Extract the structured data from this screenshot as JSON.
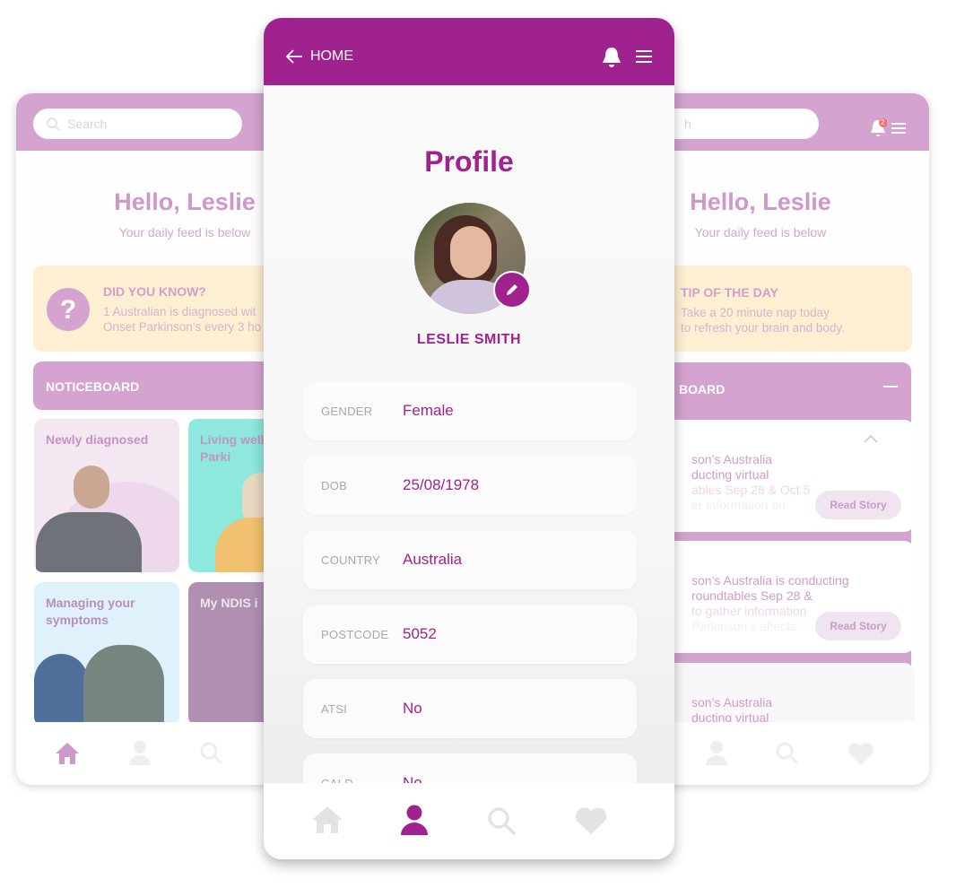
{
  "colors": {
    "brand": "#a0228f",
    "light_brand": "#d4a3cf",
    "tip_bg": "#fdf0d2",
    "inactive_icon": "#e3e3e3"
  },
  "left_phone": {
    "search_placeholder": "Search",
    "greeting": "Hello, Leslie",
    "subtitle": "Your daily feed is below",
    "did_you_know": {
      "title": "DID YOU KNOW?",
      "line1": "1 Australian is diagnosed wit",
      "line2": "Onset Parkinson’s every 3 ho"
    },
    "noticeboard_title": "NOTICEBOARD",
    "tiles": [
      {
        "label": "Newly diagnosed"
      },
      {
        "label": "Living well with Parki"
      },
      {
        "label": "Managing your symptoms"
      },
      {
        "label": "My NDIS i"
      }
    ],
    "nav": [
      "home-icon",
      "person-icon",
      "search-icon"
    ],
    "active_nav": "home"
  },
  "center_phone": {
    "back_label": "HOME",
    "title": "Profile",
    "name": "LESLIE SMITH",
    "fields": [
      {
        "label": "GENDER",
        "value": "Female"
      },
      {
        "label": "DOB",
        "value": "25/08/1978"
      },
      {
        "label": "COUNTRY",
        "value": "Australia"
      },
      {
        "label": "POSTCODE",
        "value": "5052"
      },
      {
        "label": "ATSI",
        "value": "No"
      },
      {
        "label": "CALD",
        "value": "No"
      }
    ],
    "nav": [
      "home-icon",
      "person-icon",
      "search-icon",
      "heart-icon"
    ],
    "active_nav": "profile"
  },
  "right_phone": {
    "search_placeholder": "h",
    "notification_count": "2",
    "greeting": "Hello, Leslie",
    "subtitle": "Your daily feed is below",
    "tip": {
      "title": "TIP OF THE DAY",
      "line1": "Take a 20 minute nap today",
      "line2": "to refresh your brain and body."
    },
    "noticeboard_title": "BOARD",
    "stories": [
      {
        "lines": [
          "son’s Australia",
          "ducting virtual",
          "ables Sep 28 & Oct 5",
          "er information on"
        ],
        "button": "Read Story"
      },
      {
        "lines": [
          "son’s Australia is conducting",
          "roundtables Sep 28 &",
          "to gather information",
          "Parkinson’s affects"
        ],
        "button": "Read Story"
      },
      {
        "lines": [
          "son’s Australia",
          "ducting virtual"
        ]
      }
    ],
    "nav": [
      "person-icon",
      "search-icon",
      "heart-icon"
    ]
  }
}
